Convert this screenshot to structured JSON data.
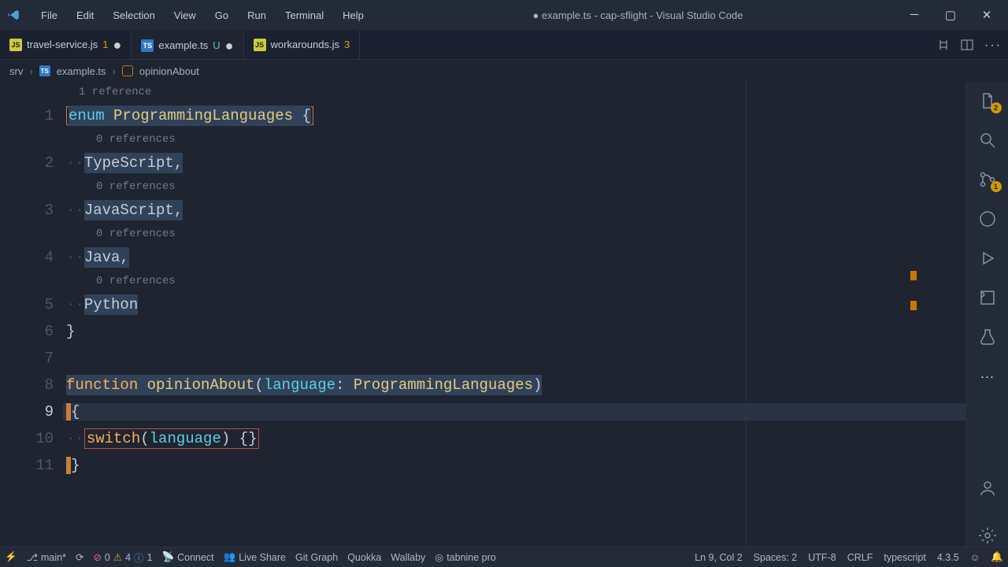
{
  "titlebar": {
    "menus": [
      "File",
      "Edit",
      "Selection",
      "View",
      "Go",
      "Run",
      "Terminal",
      "Help"
    ],
    "title": "● example.ts - cap-sflight - Visual Studio Code"
  },
  "tabs": [
    {
      "icon": "js",
      "name": "travel-service.js",
      "badge": "1",
      "dirty": true
    },
    {
      "icon": "ts",
      "name": "example.ts",
      "badge": "U",
      "dirty": true,
      "active": true
    },
    {
      "icon": "js",
      "name": "workarounds.js",
      "badge": "3",
      "dirty": false
    }
  ],
  "activity_badges": {
    "explorer": "2",
    "scm": "1"
  },
  "breadcrumb": {
    "parts": [
      "srv",
      "example.ts",
      "opinionAbout"
    ]
  },
  "codelens": {
    "line1": "1 reference",
    "refs0": "0 references"
  },
  "code": {
    "l1": {
      "enum": "enum",
      "name": "ProgrammingLanguages",
      "brace": "{"
    },
    "l2": "TypeScript,",
    "l3": "JavaScript,",
    "l4": "Java,",
    "l5": "Python",
    "l6": "}",
    "l8": {
      "func": "function",
      "name": "opinionAbout",
      "paren": "(",
      "param": "language",
      "colon": ": ",
      "type": "ProgrammingLanguages",
      "paren2": ")"
    },
    "l9": "{",
    "l10": {
      "switch": "switch",
      "paren": "(",
      "arg": "language",
      "paren2": ")",
      "body": " {}"
    },
    "l11": "}"
  },
  "statusbar": {
    "branch": "main*",
    "errors": "0",
    "warnings": "4",
    "info": "1",
    "connect": "Connect",
    "liveshare": "Live Share",
    "gitgraph": "Git Graph",
    "quokka": "Quokka",
    "wallaby": "Wallaby",
    "tabnine": "tabnine pro",
    "cursor": "Ln 9, Col 2",
    "spaces": "Spaces: 2",
    "encoding": "UTF-8",
    "eol": "CRLF",
    "lang": "typescript",
    "tsver": "4.3.5"
  },
  "chart_data": null
}
